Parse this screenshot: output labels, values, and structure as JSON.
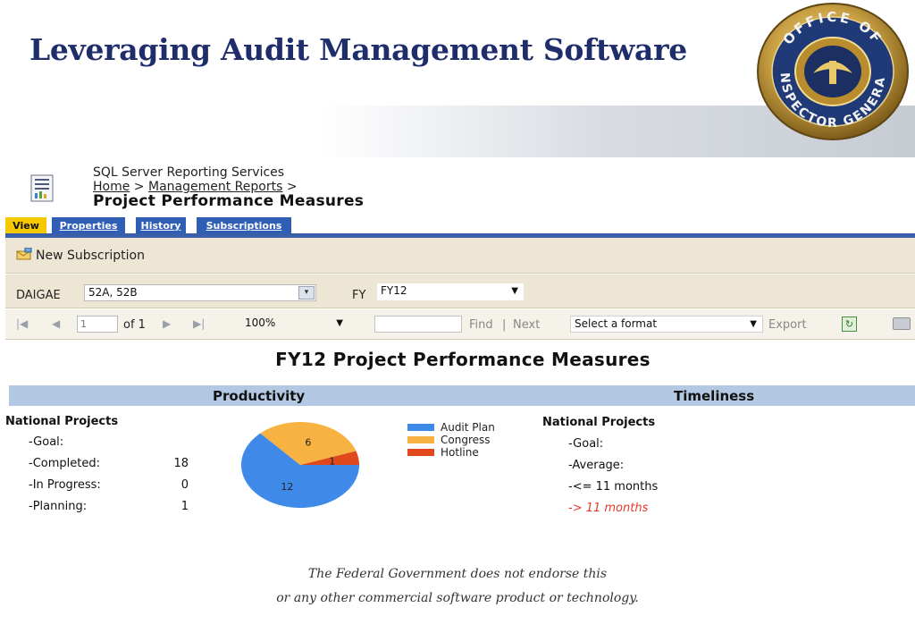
{
  "slide": {
    "title": "Leveraging Audit Management Software",
    "seal_text": "OFFICE OF INSPECTOR GENERAL",
    "disclaimer_line1": "The Federal Government does not endorse this",
    "disclaimer_line2": "or any other commercial software product or technology."
  },
  "header": {
    "service": "SQL Server Reporting Services",
    "breadcrumb": {
      "home": "Home",
      "sep1": " > ",
      "reports": "Management Reports",
      "sep2": " >"
    },
    "report_title": "Project Performance Measures"
  },
  "tabs": [
    "View",
    "Properties",
    "History",
    "Subscriptions"
  ],
  "toolbar": {
    "new_subscription": "New Subscription"
  },
  "params": {
    "daigae_label": "DAIGAE",
    "daigae_value": "52A, 52B",
    "fy_label": "FY",
    "fy_value": "FY12"
  },
  "viewer": {
    "page": "1",
    "of_label": "of 1",
    "zoom": "100%",
    "find": "Find",
    "pipe": "|",
    "next": "Next",
    "format": "Select a format",
    "export": "Export"
  },
  "report": {
    "heading": "FY12 Project Performance Measures",
    "productivity": {
      "label": "Productivity",
      "group": "National Projects",
      "rows": [
        {
          "label": "-Goal:",
          "value": ""
        },
        {
          "label": "-Completed:",
          "value": "18"
        },
        {
          "label": "-In Progress:",
          "value": "0"
        },
        {
          "label": "-Planning:",
          "value": "1"
        }
      ]
    },
    "timeliness": {
      "label": "Timeliness",
      "group": "National Projects",
      "rows": [
        "-Goal:",
        "-Average:",
        "-<= 11 months"
      ],
      "warn_row": "-> 11 months"
    }
  },
  "chart_data": {
    "type": "pie",
    "labels": [
      "Audit Plan",
      "Congress",
      "Hotline"
    ],
    "values": [
      12,
      6,
      1
    ],
    "colors": [
      "#3f8ae8",
      "#f7b241",
      "#e0481e"
    ],
    "legend": "right"
  }
}
